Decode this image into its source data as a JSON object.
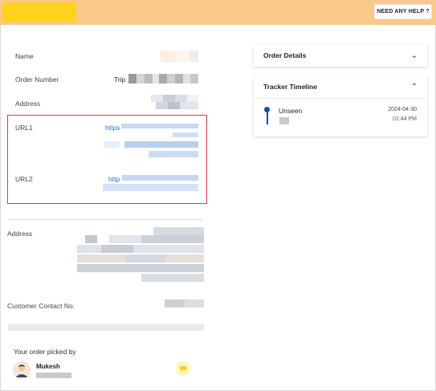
{
  "header": {
    "help_label": "NEED ANY HELP ?"
  },
  "details": {
    "name_label": "Name",
    "order_number_label": "Order Number",
    "order_number_prefix": "Trip",
    "address_label": "Address",
    "url1_label": "URL1",
    "url1_prefix": "https",
    "url2_label": "URL2",
    "url2_prefix": "http",
    "address2_label": "Address",
    "contact_label": "Customer Contact No."
  },
  "picked_by": {
    "title": "Your order picked by",
    "person_name": "Mukesh"
  },
  "order_details_panel": {
    "title": "Order Details"
  },
  "tracker_panel": {
    "title": "Tracker Timeline",
    "event_status": "Unseen",
    "event_date": "2024-04-30",
    "event_time": "01:44 PM"
  },
  "colors": {
    "topbar": "#f8c98a",
    "logo": "#ffd21f",
    "highlight_border": "#e0393e",
    "link": "#1a73e8",
    "timeline_accent": "#1450a3"
  }
}
